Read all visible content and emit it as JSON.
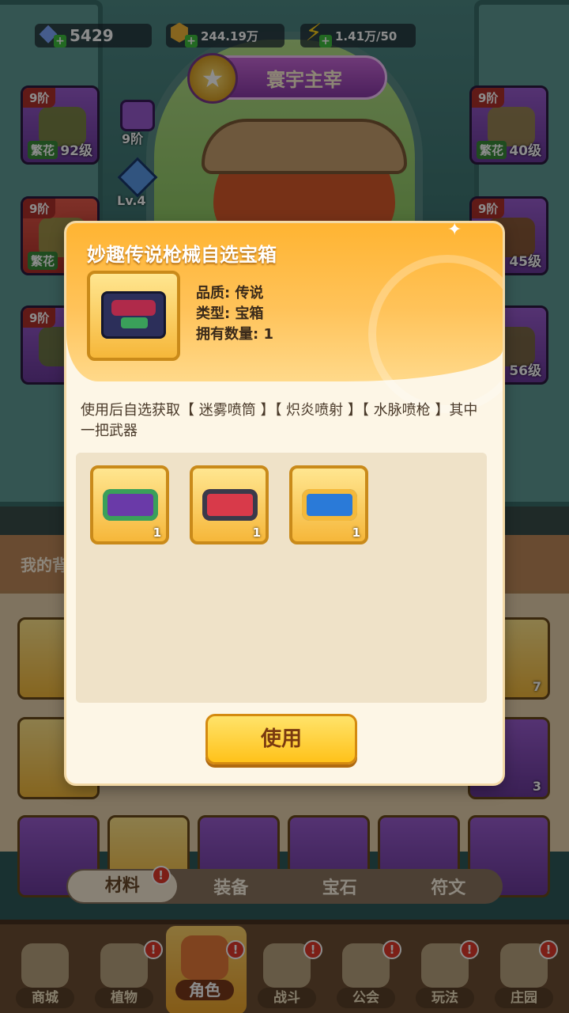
{
  "resources": {
    "gems": "5429",
    "coins": "244.19万",
    "energy": "1.41万/50"
  },
  "banner": {
    "title": "寰宇主宰"
  },
  "equipment": {
    "hat": {
      "tier": "9阶",
      "tag": "繁花",
      "level": "92级"
    },
    "glove": {
      "tier": "9阶",
      "tag": "繁花"
    },
    "pants": {
      "tier": "9阶"
    },
    "top": {
      "tier": "9阶",
      "tag": "繁花",
      "level": "40级"
    },
    "belt": {
      "tier": "9阶",
      "level": "45级"
    },
    "boots": {
      "level": "56级"
    },
    "side_tier": "9阶",
    "side_level": "Lv.4"
  },
  "bag": {
    "header": "我的背包",
    "counts": [
      "7",
      "3"
    ]
  },
  "modal": {
    "title": "妙趣传说枪械自选宝箱",
    "quality": "品质: 传说",
    "type": "类型: 宝箱",
    "owned": "拥有数量: 1",
    "description": "使用后自选获取【 迷雾喷筒 】【 炽炎喷射 】【 水脉喷枪 】其中一把武器",
    "rewards": [
      {
        "name": "迷雾喷筒",
        "count": "1",
        "color": "#6a3aa8"
      },
      {
        "name": "炽炎喷射",
        "count": "1",
        "color": "#d83a4a"
      },
      {
        "name": "水脉喷枪",
        "count": "1",
        "color": "#2a7ad8"
      }
    ],
    "use_button": "使用"
  },
  "tabs": [
    {
      "label": "材料",
      "active": true
    },
    {
      "label": "装备"
    },
    {
      "label": "宝石"
    },
    {
      "label": "符文"
    }
  ],
  "nav": [
    {
      "label": "商城"
    },
    {
      "label": "植物"
    },
    {
      "label": "角色",
      "active": true
    },
    {
      "label": "战斗"
    },
    {
      "label": "公会"
    },
    {
      "label": "玩法"
    },
    {
      "label": "庄园"
    }
  ],
  "badge_text": "!"
}
